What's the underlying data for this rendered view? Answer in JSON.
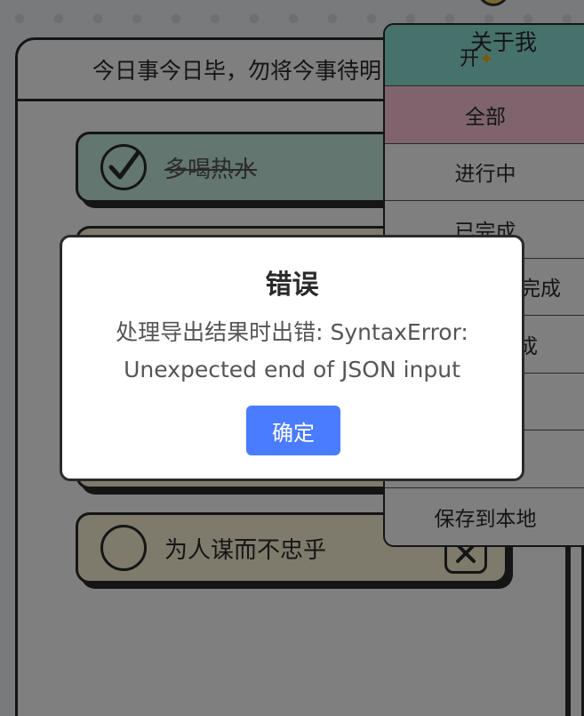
{
  "header": {
    "motto": "今日事今日毕，勿将今事待明日"
  },
  "todos": [
    {
      "text": "多喝热水",
      "done": true
    },
    {
      "text": "为人谋而不忠乎",
      "done": false
    }
  ],
  "menu": {
    "about": "关于我",
    "open": "开",
    "items": [
      {
        "label": "全部"
      },
      {
        "label": "进行中"
      },
      {
        "label": "已完成"
      },
      {
        "label": "完成"
      },
      {
        "label": "成"
      },
      {
        "label": ""
      },
      {
        "label": ""
      },
      {
        "label": "保存到本地"
      }
    ]
  },
  "dialog": {
    "title": "错误",
    "message": "处理导出结果时出错: SyntaxError: Unexpected end of JSON input",
    "confirm_label": "确定"
  },
  "colors": {
    "accent": "#4a7cff",
    "mint": "#8ee3d6",
    "pink": "#ffc9dd",
    "cream": "#fff7d8",
    "done_green": "#c7ecdf"
  }
}
